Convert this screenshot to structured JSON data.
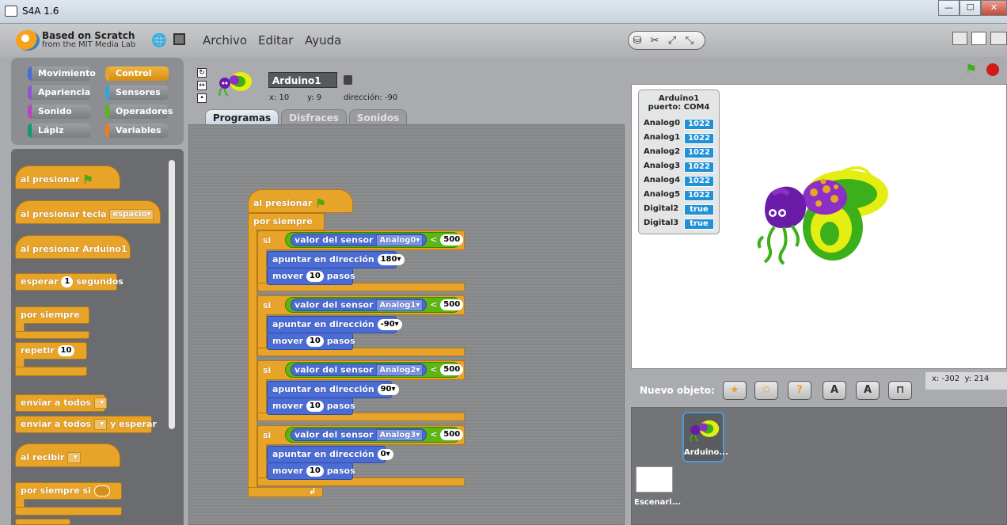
{
  "window": {
    "title": "S4A 1.6",
    "minimize": "—",
    "maximize": "☐",
    "close": "✕"
  },
  "brand": {
    "line1": "Based on Scratch",
    "line2": "from the MIT Media Lab"
  },
  "menu": [
    "Archivo",
    "Editar",
    "Ayuda"
  ],
  "categories": [
    {
      "label": "Movimiento",
      "color": "#4a6cd4"
    },
    {
      "label": "Control",
      "color": "#e8a428"
    },
    {
      "label": "Apariencia",
      "color": "#8a55d7"
    },
    {
      "label": "Sensores",
      "color": "#2ca5e2"
    },
    {
      "label": "Sonido",
      "color": "#bb42c3"
    },
    {
      "label": "Operadores",
      "color": "#5cb712"
    },
    {
      "label": "Lápiz",
      "color": "#0e9a6c"
    },
    {
      "label": "Variables",
      "color": "#ee7d16"
    }
  ],
  "palette": {
    "when_flag": "al presionar",
    "when_key": "al presionar tecla",
    "key_value": "espacio",
    "when_sprite": "al presionar Arduino1",
    "wait": "esperar",
    "wait_value": "1",
    "wait_unit": "segundos",
    "forever": "por siempre",
    "repeat": "repetir",
    "repeat_value": "10",
    "broadcast": "enviar a todos",
    "broadcast_wait": "enviar a todos",
    "and_wait": "y esperar",
    "when_receive": "al recibir",
    "forever_if": "por siempre si"
  },
  "sprite": {
    "name": "Arduino1",
    "x": "x: 10",
    "y": "y: 9",
    "direction": "dirección: -90"
  },
  "tabs": [
    "Programas",
    "Disfraces",
    "Sonidos"
  ],
  "script": {
    "hat": "al presionar",
    "forever": "por siempre",
    "if_label": "si",
    "sensor_label": "valor del sensor",
    "lt": "<",
    "point_label": "apuntar en dirección",
    "move_label": "mover",
    "steps": "pasos",
    "branches": [
      {
        "sensor": "Analog0",
        "threshold": "500",
        "direction": "180",
        "move": "10"
      },
      {
        "sensor": "Analog1",
        "threshold": "500",
        "direction": "-90",
        "move": "10"
      },
      {
        "sensor": "Analog2",
        "threshold": "500",
        "direction": "90",
        "move": "10"
      },
      {
        "sensor": "Analog3",
        "threshold": "500",
        "direction": "0",
        "move": "10"
      }
    ]
  },
  "monitor": {
    "title1": "Arduino1",
    "title2": "puerto: COM4",
    "rows": [
      {
        "label": "Analog0",
        "value": "1022"
      },
      {
        "label": "Analog1",
        "value": "1022"
      },
      {
        "label": "Analog2",
        "value": "1022"
      },
      {
        "label": "Analog3",
        "value": "1022"
      },
      {
        "label": "Analog4",
        "value": "1022"
      },
      {
        "label": "Analog5",
        "value": "1022"
      },
      {
        "label": "Digital2",
        "value": "true"
      },
      {
        "label": "Digital3",
        "value": "true"
      }
    ]
  },
  "new_object": {
    "label": "Nuevo objeto:"
  },
  "mouse": {
    "x": "x: -302",
    "y": "y: 214"
  },
  "sprite_list": {
    "stage_label": "Escenari...",
    "sprite_label": "Arduino..."
  }
}
